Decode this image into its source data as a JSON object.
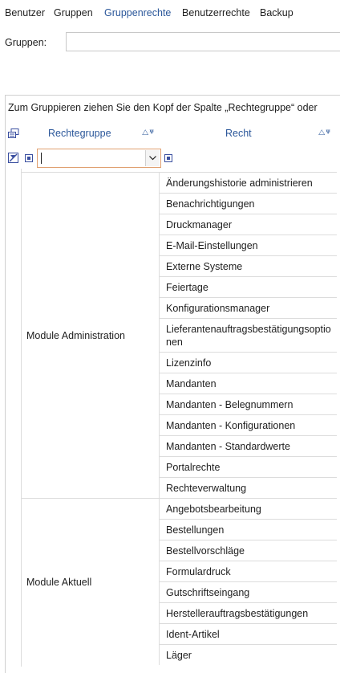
{
  "tabs": [
    "Benutzer",
    "Gruppen",
    "Gruppenrechte",
    "Benutzerrechte",
    "Backup"
  ],
  "active_tab": "Gruppenrechte",
  "filter": {
    "label": "Gruppen:",
    "value": ""
  },
  "group_panel_text": "Zum Gruppieren ziehen Sie den Kopf der Spalte „Rechtegruppe“ oder",
  "columns": {
    "group": "Rechtegruppe",
    "right": "Recht",
    "sort_indicator": "△ⱋ"
  },
  "groups": [
    {
      "name": "Module Administration",
      "rights": [
        "Änderungshistorie administrieren",
        "Benachrichtigungen",
        "Druckmanager",
        "E-Mail-Einstellungen",
        "Externe Systeme",
        "Feiertage",
        "Konfigurationsmanager",
        "Lieferantenauftragsbestätigungsoptionen",
        "Lizenzinfo",
        "Mandanten",
        "Mandanten - Belegnummern",
        "Mandanten - Konfigurationen",
        "Mandanten - Standardwerte",
        "Portalrechte",
        "Rechteverwaltung"
      ]
    },
    {
      "name": "Module Aktuell",
      "rights": [
        "Angebotsbearbeitung",
        "Bestellungen",
        "Bestellvorschläge",
        "Formulardruck",
        "Gutschriftseingang",
        "Herstellerauftragsbestätigungen",
        "Ident-Artikel",
        "Läger"
      ]
    }
  ]
}
